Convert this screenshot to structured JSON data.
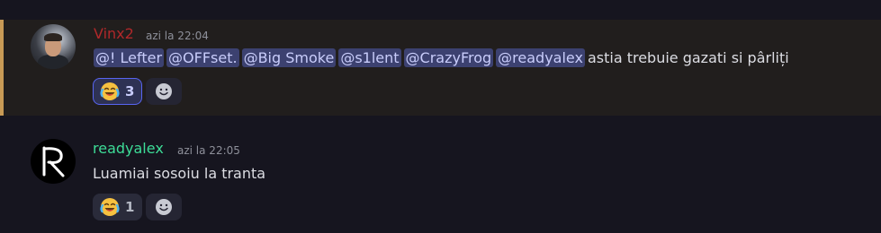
{
  "messages": [
    {
      "username": "Vinx2",
      "timestamp": "azi la 22:04",
      "username_color": "#b0282a",
      "highlighted": true,
      "mentions": [
        "@! Lefter",
        "@OFFset.",
        "@Big Smoke",
        "@s1lent",
        "@CrazyFrog",
        "@readyalex"
      ],
      "text": "astia trebuie gazati si pârliți",
      "reaction": {
        "emoji": "joy-emoji",
        "count": "3"
      }
    },
    {
      "username": "readyalex",
      "timestamp": "azi la 22:05",
      "username_color": "#3ddc97",
      "text": "Luamiai sosoiu la tranta",
      "reaction": {
        "emoji": "joy-emoji",
        "count": "1"
      }
    }
  ],
  "colors": {
    "background": "#16151f",
    "highlight_bg": "#211e1d",
    "highlight_border": "#c89a55",
    "mention_bg": "#3c4170",
    "mention_text": "#c9cdfb"
  },
  "icons": {
    "add_reaction": "smiley-icon",
    "reaction_emoji": "face-with-tears-of-joy"
  }
}
